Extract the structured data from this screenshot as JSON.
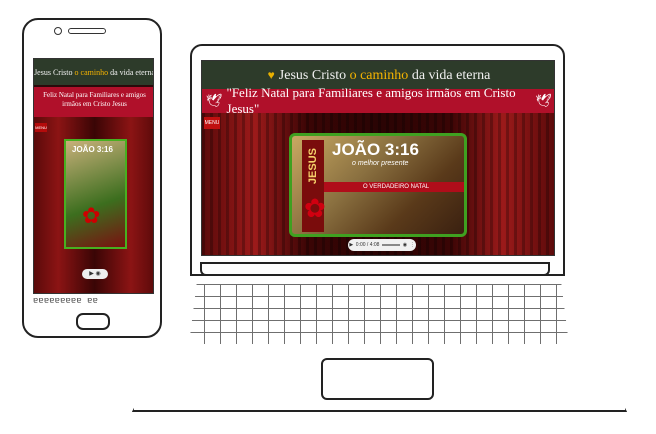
{
  "phone": {
    "header": {
      "title_part1": "Jesus Cristo ",
      "title_accent": "o caminho",
      "title_part2": " da vida eterna"
    },
    "banner": "Feliz Natal para Familiares e amigos irmãos em Cristo Jesus",
    "menu_label": "MENU",
    "card": {
      "title": "JOÃO 3:16"
    },
    "keys_text": "ɐɐɐɐɐɐɐɐɐ ɐɐ"
  },
  "laptop": {
    "header": {
      "heart_icon": "heart-icon",
      "title_part1": "Jesus Cristo ",
      "title_accent": "o caminho",
      "title_part2": " da vida eterna"
    },
    "banner": "\"Feliz Natal para Familiares e amigos irmãos em Cristo Jesus\"",
    "menu_label": "MENU",
    "card": {
      "side_label": "JESUS",
      "title": "JOÃO 3:16",
      "subtitle": "o melhor presente",
      "ribbon": "O VERDADEIRO NATAL"
    },
    "audio": {
      "time": "0:00 / 4:08"
    }
  },
  "colors": {
    "header_bg": "#2d3b2a",
    "banner_bg": "#b0102a",
    "accent": "#f6b400",
    "curtain": "#8c1414",
    "card_border": "#3fa020"
  }
}
